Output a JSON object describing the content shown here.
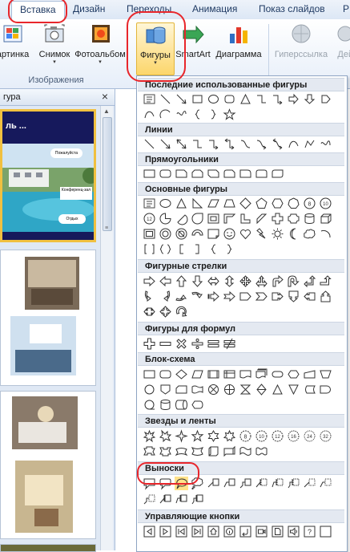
{
  "tabs": [
    {
      "label": "Вставка",
      "active": true
    },
    {
      "label": "Дизайн",
      "active": false
    },
    {
      "label": "Переходы",
      "active": false
    },
    {
      "label": "Анимация",
      "active": false
    },
    {
      "label": "Показ слайдов",
      "active": false
    },
    {
      "label": "Р",
      "active": false
    }
  ],
  "ribbon": {
    "buttons": [
      {
        "label": "артинка",
        "icon": "picture-icon"
      },
      {
        "label": "Снимок",
        "icon": "screenshot-icon"
      },
      {
        "label": "Фотоальбом",
        "icon": "photo-album-icon"
      },
      {
        "label": "Фигуры",
        "icon": "shapes-icon"
      },
      {
        "label": "SmartArt",
        "icon": "smartart-icon"
      },
      {
        "label": "Диаграмма",
        "icon": "chart-icon"
      },
      {
        "label": "Гиперссылка",
        "icon": "hyperlink-icon",
        "disabled": true
      },
      {
        "label": "Дейс",
        "icon": "action-icon"
      }
    ],
    "group_label": "Изображения"
  },
  "pane": {
    "title": "гура",
    "close": "×"
  },
  "slide1": {
    "title": "ль ...",
    "callouts": [
      "Пожалуйста",
      "Конференц-зал",
      "Отдых"
    ]
  },
  "gallery": {
    "sections": [
      {
        "title": "Последние использованные фигуры"
      },
      {
        "title": "Линии"
      },
      {
        "title": "Прямоугольники"
      },
      {
        "title": "Основные фигуры"
      },
      {
        "title": "Фигурные стрелки"
      },
      {
        "title": "Фигуры для формул"
      },
      {
        "title": "Блок-схема"
      },
      {
        "title": "Звезды и ленты"
      },
      {
        "title": "Выноски"
      },
      {
        "title": "Управляющие кнопки"
      }
    ]
  },
  "colors": {
    "highlight": "#e8262b",
    "accent": "#f0c040",
    "ribbon_text": "#1f3a63"
  }
}
